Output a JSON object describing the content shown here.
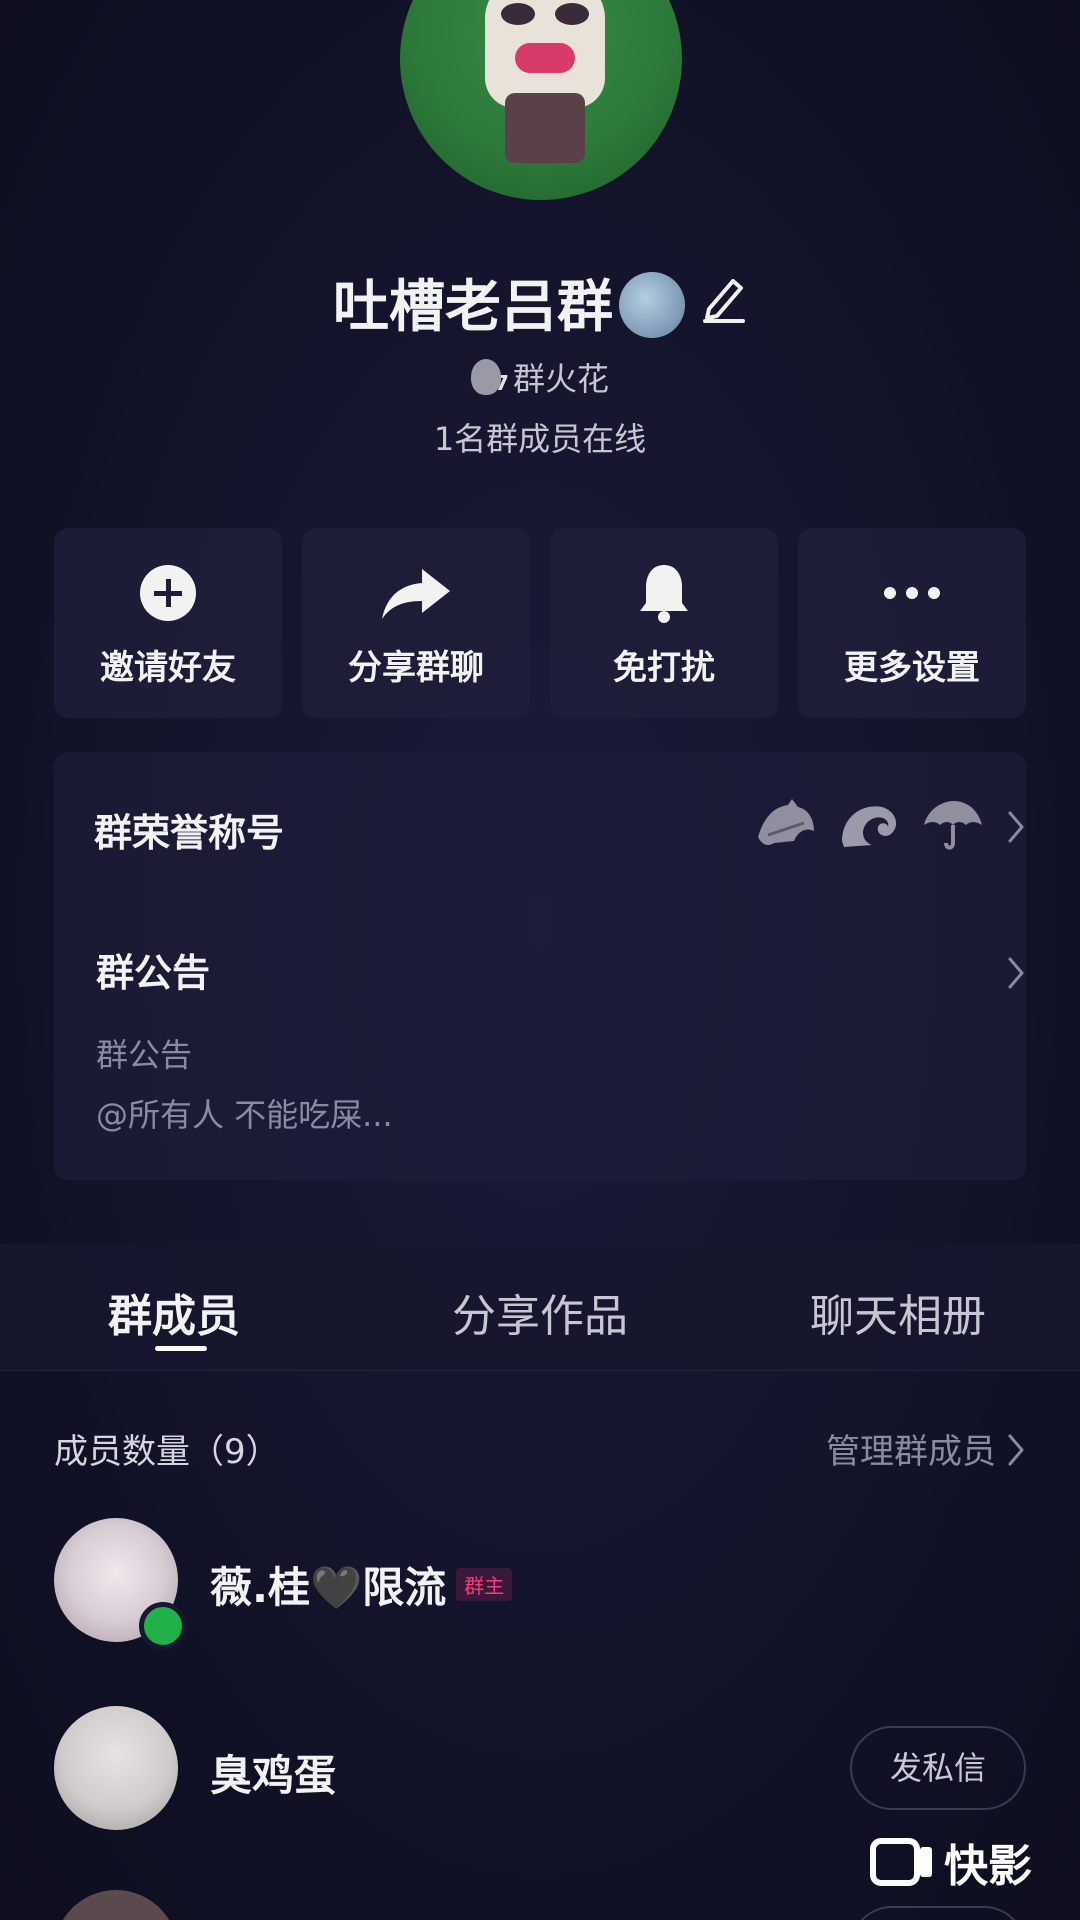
{
  "group": {
    "name": "吐槽老吕群",
    "spark_count": "7",
    "spark_label": "群火花",
    "online_text": "1名群成员在线"
  },
  "actions": [
    {
      "label": "邀请好友",
      "icon": "plus-circle-icon"
    },
    {
      "label": "分享群聊",
      "icon": "share-arrow-icon"
    },
    {
      "label": "免打扰",
      "icon": "bell-icon"
    },
    {
      "label": "更多设置",
      "icon": "more-dots-icon"
    }
  ],
  "info": {
    "honor_label": "群荣誉称号",
    "notice_title": "群公告",
    "notice_sub": "群公告",
    "notice_body": "@所有人 不能吃屎..."
  },
  "tabs": [
    {
      "label": "群成员",
      "active": true
    },
    {
      "label": "分享作品",
      "active": false
    },
    {
      "label": "聊天相册",
      "active": false
    }
  ],
  "members_section": {
    "count_label": "成员数量（9）",
    "manage_label": "管理群成员"
  },
  "members": [
    {
      "name": "薇.桂🖤限流",
      "badge": "群主",
      "online": true
    },
    {
      "name": "臭鸡蛋",
      "button": "发私信"
    }
  ],
  "watermark": {
    "text": "快影"
  },
  "colors": {
    "background": "#14142a",
    "card": "#1e1e3a",
    "online_green": "#22b04a",
    "owner_badge": "#ff3a7a"
  }
}
